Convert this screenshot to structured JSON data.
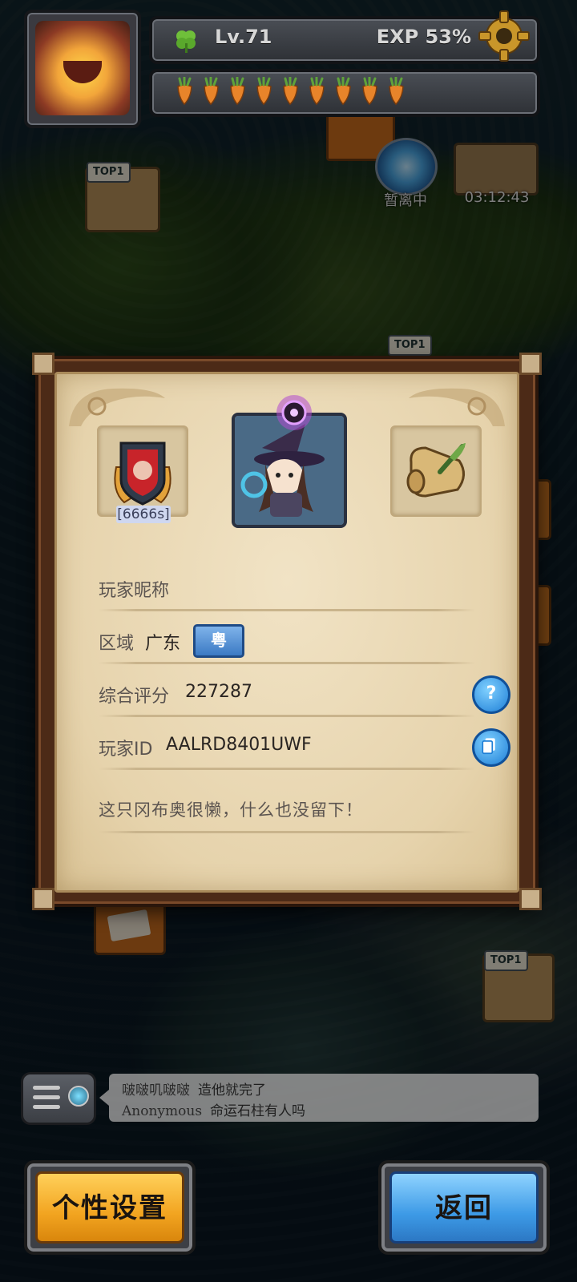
{
  "hud": {
    "level": "Lv.71",
    "exp": "EXP 53%",
    "carrot_count": 9
  },
  "map": {
    "portal_status": "暂离中",
    "chest_timer": "03:12:43",
    "top_badge": "TOP1"
  },
  "dialog": {
    "badge_tag": "[6666s]",
    "nickname_label": "玩家昵称",
    "nickname_value": "",
    "region_label": "区域",
    "region_value": "广东",
    "region_tag": "粤",
    "score_label": "综合评分",
    "score_value": "227287",
    "help_icon": "?",
    "id_label": "玩家ID",
    "id_value": "AALRD8401UWF",
    "bio": "这只冈布奥很懒，什么也没留下！"
  },
  "chat": {
    "messages": [
      {
        "user": "啵啵叽啵啵",
        "text": "造他就完了"
      },
      {
        "user": "Anonymous",
        "text": "命运石柱有人吗"
      }
    ]
  },
  "buttons": {
    "settings": "个性设置",
    "back": "返回"
  },
  "colors": {
    "accent_orange": "#f2a420",
    "accent_blue": "#3d9ae6",
    "paper": "#f1e3c5"
  }
}
